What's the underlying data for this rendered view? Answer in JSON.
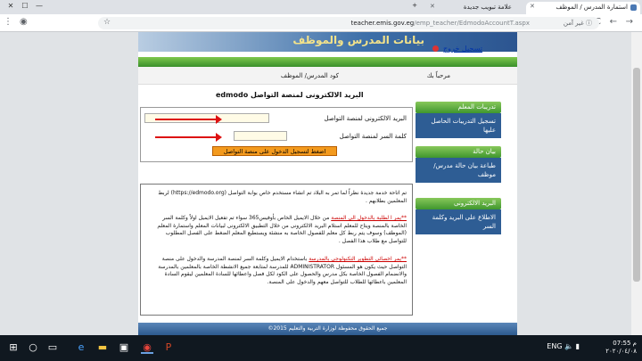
{
  "browser": {
    "tabs": [
      {
        "label": "استمارة المدرس / الموظف",
        "active": true
      },
      {
        "label": "علامة تبويب جديدة",
        "active": false
      }
    ],
    "url_host": "teacher.emis.gov.eg",
    "url_path": "/emp_teacher/EdmodoAccountT.aspx",
    "security_label": "غير آمن",
    "nav": {
      "back": "←",
      "forward": "→",
      "reload": "C",
      "home": "⌂"
    }
  },
  "header": {
    "banner_title": "بيانات المدرس والموظف",
    "logout_label": "تسجيل خروج"
  },
  "infobar": {
    "welcome": "مرحباً بك",
    "code_label": "كود المدرس/ الموظف"
  },
  "sidebar": {
    "blocks": [
      {
        "head": "تدريبات المعلم",
        "body": "تسجيل التدريبات الحاصل عليها"
      },
      {
        "head": "بيان حالة",
        "body": "طباعة بيان حالة مدرس/ موظف"
      },
      {
        "head": "البريد الالكترونى",
        "body": "الاطلاع على البريد وكلمة السر"
      }
    ]
  },
  "main": {
    "section_title": "البريد الالكترونى لمنصة التواصل edmodo",
    "email_label": "البريد الالكترونى لمنصة التواصل",
    "password_label": "كلمة السر لمنصة التواصل",
    "login_button": "اضغط لتسجيل الدخول على منصة التواصل",
    "notes": {
      "p1": "تم اتاحة خدمة جديدة نظراً لما تمر به البلاد تم انشاء مستخدم خاص بوابة التواصل (https://edmodo.org) لربط المعلمين بطلابهم .",
      "p2_head": "**يمر ا لطلبة بالدخول الى المنصة",
      "p2_body": "من خلال الايميل الخاص بأوفيس365 سواء تم تفعيل الايميل اولاً وكلمة السر الخاصة بالمنصة ويتاح للمعلم استلام البريد الالكترونى من خلال التطبيق الالكترونى لبيانات المعلم واستمارة المعلم (الموظف) وسوف يتم ربط كل معلم للفصول الخاصة به منشئة ويستطيع المعلم الضغط على الفصل المطلوب للتواصل مع طلاب هذا الفصل .",
      "p3_head": "**يمر اخصائى التطوير التكنولوجى بالمدرسة",
      "p3_body": "باستخدام الايميل وكلمة السر لمنصة المدرسة والدخول على منصة التواصل حيث يكون هو المسئول ADMINISTRATOR للمدرسة لمتابعة جميع الانشطة الخاصة بالمعلمين بالمدرسة والانضمام الفصول الخاصة بكل مدرس والحصول على الكود لكل فصل واعطائها للسادة المعلمين ليقوم السادة المعلمين باعطائها للطلاب للتواصل معهم والدخول على المنصة."
    }
  },
  "footer": {
    "text": "جميع الحقوق محفوظة لوزارة التربية والتعليم 2015©"
  },
  "taskbar": {
    "time": "07:55 م",
    "date": "٢٠٢٠/٠٤/٠٨",
    "lang": "ENG"
  },
  "colors": {
    "banner_blue": "#2c5590",
    "green_bar": "#3a8f2b",
    "login_orange": "#f39a1e",
    "arrow_red": "#d11111",
    "sidebar_blue": "#2e5d94"
  }
}
